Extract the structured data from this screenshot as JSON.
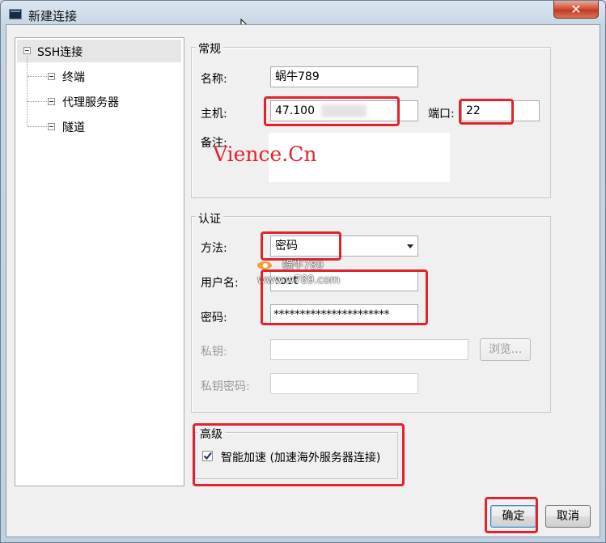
{
  "window": {
    "title": "新建连接",
    "close_symbol": "✕"
  },
  "tree": {
    "root": "SSH连接",
    "children": [
      "终端",
      "代理服务器",
      "隧道"
    ]
  },
  "general": {
    "title": "常规",
    "name_label": "名称:",
    "name_value": "蜗牛789",
    "host_label": "主机:",
    "host_value": "47.100",
    "port_label": "端口:",
    "port_value": "22",
    "note_label": "备注:",
    "note_value": ""
  },
  "watermark": {
    "main": "Vience.Cn",
    "secondary_1": "蜗牛789",
    "secondary_2": "www.w789.com"
  },
  "auth": {
    "title": "认证",
    "method_label": "方法:",
    "method_value": "密码",
    "user_label": "用户名:",
    "user_value": "root",
    "password_label": "密码:",
    "password_value": "**********************",
    "key_label": "私钥:",
    "key_value": "",
    "browse_label": "浏览...",
    "key_password_label": "私钥密码:",
    "key_password_value": ""
  },
  "advanced": {
    "title": "高级",
    "accel_label": "智能加速 (加速海外服务器连接)",
    "accel_checked": true
  },
  "buttons": {
    "ok": "确定",
    "cancel": "取消"
  },
  "colors": {
    "highlight": "#e0242d",
    "title_bg": "#c6d5e4",
    "client_bg": "#f0f0f0"
  }
}
